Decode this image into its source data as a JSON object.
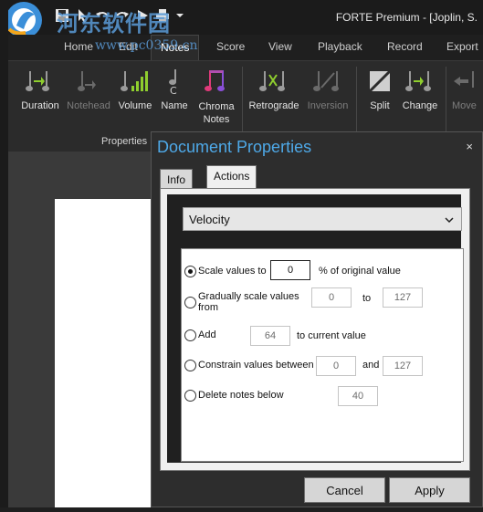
{
  "app": {
    "title": "FORTE Premium - [Joplin, S.",
    "watermark_cn": "河东软件园",
    "watermark_url": "www.pc0359.cn"
  },
  "ribbon_tabs": [
    "Home",
    "Edit",
    "Notes",
    "Score",
    "View",
    "Playback",
    "Record",
    "Export"
  ],
  "active_tab": "Notes",
  "ribbon": {
    "buttons": [
      {
        "label": "Duration",
        "icon": "note-duration-icon",
        "enabled": true
      },
      {
        "label": "Notehead",
        "icon": "notehead-icon",
        "enabled": false
      },
      {
        "label": "Volume",
        "icon": "volume-bars-icon",
        "enabled": true
      },
      {
        "label": "Name",
        "icon": "note-name-icon",
        "enabled": true
      },
      {
        "label": "Chroma\nNotes",
        "icon": "chroma-notes-icon",
        "enabled": true
      },
      {
        "label": "Retrograde",
        "icon": "retrograde-icon",
        "enabled": true
      },
      {
        "label": "Inversion",
        "icon": "inversion-icon",
        "enabled": false
      },
      {
        "label": "Split",
        "icon": "split-icon",
        "enabled": true
      },
      {
        "label": "Change",
        "icon": "change-icon",
        "enabled": true
      },
      {
        "label": "Move",
        "icon": "move-icon",
        "enabled": false
      }
    ],
    "group_label": "Properties"
  },
  "dialog": {
    "title": "Document Properties",
    "close": "×",
    "tabs": [
      "Info",
      "Actions"
    ],
    "active_tab": "Actions",
    "property_select": "Velocity",
    "options": {
      "scale": {
        "label": "Scale values to",
        "value": "0",
        "suffix": "% of original value",
        "selected": true
      },
      "gradual": {
        "label": "Gradually scale values\nfrom",
        "from": "0",
        "to_label": "to",
        "to": "127",
        "selected": false
      },
      "add": {
        "label": "Add",
        "value": "64",
        "suffix": "to current value",
        "selected": false
      },
      "constrain": {
        "label": "Constrain values between",
        "min": "0",
        "and_label": "and",
        "max": "127",
        "selected": false
      },
      "delete": {
        "label": "Delete notes below",
        "value": "40",
        "selected": false
      }
    },
    "buttons": {
      "cancel": "Cancel",
      "apply": "Apply"
    }
  },
  "colors": {
    "accent": "#4ea9e8",
    "ribbon_bg": "#2b2b2b",
    "titlebar_bg": "#1b1b1b"
  }
}
